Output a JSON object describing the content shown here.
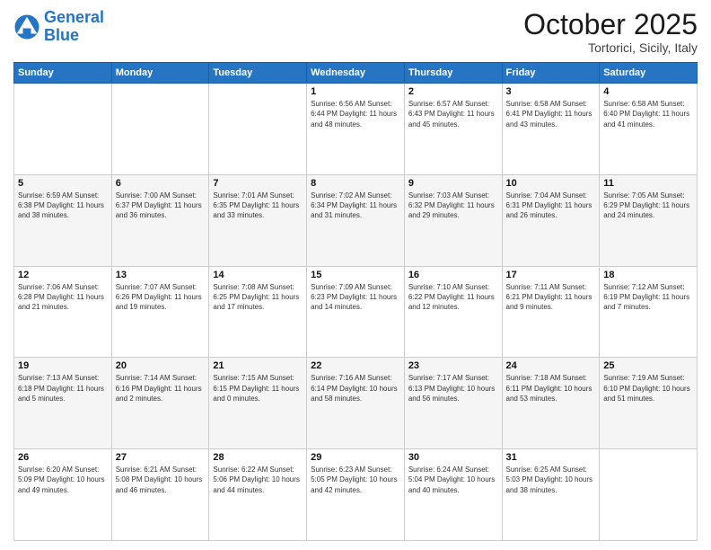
{
  "header": {
    "logo_general": "General",
    "logo_blue": "Blue",
    "month": "October 2025",
    "location": "Tortorici, Sicily, Italy"
  },
  "days_of_week": [
    "Sunday",
    "Monday",
    "Tuesday",
    "Wednesday",
    "Thursday",
    "Friday",
    "Saturday"
  ],
  "weeks": [
    [
      {
        "num": "",
        "info": ""
      },
      {
        "num": "",
        "info": ""
      },
      {
        "num": "",
        "info": ""
      },
      {
        "num": "1",
        "info": "Sunrise: 6:56 AM\nSunset: 6:44 PM\nDaylight: 11 hours\nand 48 minutes."
      },
      {
        "num": "2",
        "info": "Sunrise: 6:57 AM\nSunset: 6:43 PM\nDaylight: 11 hours\nand 45 minutes."
      },
      {
        "num": "3",
        "info": "Sunrise: 6:58 AM\nSunset: 6:41 PM\nDaylight: 11 hours\nand 43 minutes."
      },
      {
        "num": "4",
        "info": "Sunrise: 6:58 AM\nSunset: 6:40 PM\nDaylight: 11 hours\nand 41 minutes."
      }
    ],
    [
      {
        "num": "5",
        "info": "Sunrise: 6:59 AM\nSunset: 6:38 PM\nDaylight: 11 hours\nand 38 minutes."
      },
      {
        "num": "6",
        "info": "Sunrise: 7:00 AM\nSunset: 6:37 PM\nDaylight: 11 hours\nand 36 minutes."
      },
      {
        "num": "7",
        "info": "Sunrise: 7:01 AM\nSunset: 6:35 PM\nDaylight: 11 hours\nand 33 minutes."
      },
      {
        "num": "8",
        "info": "Sunrise: 7:02 AM\nSunset: 6:34 PM\nDaylight: 11 hours\nand 31 minutes."
      },
      {
        "num": "9",
        "info": "Sunrise: 7:03 AM\nSunset: 6:32 PM\nDaylight: 11 hours\nand 29 minutes."
      },
      {
        "num": "10",
        "info": "Sunrise: 7:04 AM\nSunset: 6:31 PM\nDaylight: 11 hours\nand 26 minutes."
      },
      {
        "num": "11",
        "info": "Sunrise: 7:05 AM\nSunset: 6:29 PM\nDaylight: 11 hours\nand 24 minutes."
      }
    ],
    [
      {
        "num": "12",
        "info": "Sunrise: 7:06 AM\nSunset: 6:28 PM\nDaylight: 11 hours\nand 21 minutes."
      },
      {
        "num": "13",
        "info": "Sunrise: 7:07 AM\nSunset: 6:26 PM\nDaylight: 11 hours\nand 19 minutes."
      },
      {
        "num": "14",
        "info": "Sunrise: 7:08 AM\nSunset: 6:25 PM\nDaylight: 11 hours\nand 17 minutes."
      },
      {
        "num": "15",
        "info": "Sunrise: 7:09 AM\nSunset: 6:23 PM\nDaylight: 11 hours\nand 14 minutes."
      },
      {
        "num": "16",
        "info": "Sunrise: 7:10 AM\nSunset: 6:22 PM\nDaylight: 11 hours\nand 12 minutes."
      },
      {
        "num": "17",
        "info": "Sunrise: 7:11 AM\nSunset: 6:21 PM\nDaylight: 11 hours\nand 9 minutes."
      },
      {
        "num": "18",
        "info": "Sunrise: 7:12 AM\nSunset: 6:19 PM\nDaylight: 11 hours\nand 7 minutes."
      }
    ],
    [
      {
        "num": "19",
        "info": "Sunrise: 7:13 AM\nSunset: 6:18 PM\nDaylight: 11 hours\nand 5 minutes."
      },
      {
        "num": "20",
        "info": "Sunrise: 7:14 AM\nSunset: 6:16 PM\nDaylight: 11 hours\nand 2 minutes."
      },
      {
        "num": "21",
        "info": "Sunrise: 7:15 AM\nSunset: 6:15 PM\nDaylight: 11 hours\nand 0 minutes."
      },
      {
        "num": "22",
        "info": "Sunrise: 7:16 AM\nSunset: 6:14 PM\nDaylight: 10 hours\nand 58 minutes."
      },
      {
        "num": "23",
        "info": "Sunrise: 7:17 AM\nSunset: 6:13 PM\nDaylight: 10 hours\nand 56 minutes."
      },
      {
        "num": "24",
        "info": "Sunrise: 7:18 AM\nSunset: 6:11 PM\nDaylight: 10 hours\nand 53 minutes."
      },
      {
        "num": "25",
        "info": "Sunrise: 7:19 AM\nSunset: 6:10 PM\nDaylight: 10 hours\nand 51 minutes."
      }
    ],
    [
      {
        "num": "26",
        "info": "Sunrise: 6:20 AM\nSunset: 5:09 PM\nDaylight: 10 hours\nand 49 minutes."
      },
      {
        "num": "27",
        "info": "Sunrise: 6:21 AM\nSunset: 5:08 PM\nDaylight: 10 hours\nand 46 minutes."
      },
      {
        "num": "28",
        "info": "Sunrise: 6:22 AM\nSunset: 5:06 PM\nDaylight: 10 hours\nand 44 minutes."
      },
      {
        "num": "29",
        "info": "Sunrise: 6:23 AM\nSunset: 5:05 PM\nDaylight: 10 hours\nand 42 minutes."
      },
      {
        "num": "30",
        "info": "Sunrise: 6:24 AM\nSunset: 5:04 PM\nDaylight: 10 hours\nand 40 minutes."
      },
      {
        "num": "31",
        "info": "Sunrise: 6:25 AM\nSunset: 5:03 PM\nDaylight: 10 hours\nand 38 minutes."
      },
      {
        "num": "",
        "info": ""
      }
    ]
  ]
}
